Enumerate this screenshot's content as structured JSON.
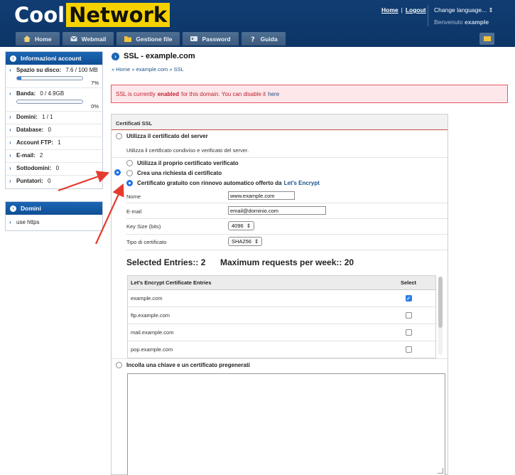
{
  "header": {
    "logo_part1": "Cool",
    "logo_part2": "Network",
    "home_link": "Home",
    "separator": "|",
    "logout_link": "Logout",
    "language": "Change language... ⇕",
    "welcome_prefix": "Benvenuto",
    "welcome_user": "example"
  },
  "nav": {
    "tabs": [
      {
        "label": "Home",
        "icon": "home-icon"
      },
      {
        "label": "Webmail",
        "icon": "mail-icon"
      },
      {
        "label": "Gestione file",
        "icon": "folder-icon"
      },
      {
        "label": "Password",
        "icon": "key-icon"
      },
      {
        "label": "Guida",
        "icon": "help-icon"
      }
    ]
  },
  "sidebar": {
    "account_title": "Informazioni account",
    "disk_label": "Spazio su disco:",
    "disk_value": "7.6 / 100 MB",
    "disk_percent": "7%",
    "disk_fraction": 0.07,
    "band_label": "Banda:",
    "band_value": "0 / 4.9GB",
    "band_percent": "0%",
    "band_fraction": 0,
    "items": [
      {
        "label": "Domini:",
        "value": "1 / 1"
      },
      {
        "label": "Database:",
        "value": "0"
      },
      {
        "label": "Account FTP:",
        "value": "1"
      },
      {
        "label": "E-mail:",
        "value": "2"
      },
      {
        "label": "Sottodomini:",
        "value": "0"
      },
      {
        "label": "Puntatori:",
        "value": "0"
      }
    ],
    "domains_title": "Domini",
    "domains_link": "use https"
  },
  "page": {
    "title": "SSL - example.com",
    "breadcrumb": [
      "Home",
      "example.com",
      "SSL"
    ],
    "crumb_sep": "»",
    "alert_prefix": "SSL is currently",
    "alert_bold": "enabled",
    "alert_suffix": "for this domain. You can disable it",
    "alert_link": "here"
  },
  "ssl": {
    "section_title": "Certificati SSL",
    "opt_server": "Utilizza il certificato del server",
    "opt_server_desc": "Utilizza il certificato condiviso e verificato del server.",
    "opt_own": "Utilizza il proprio certificato verificato",
    "opt_request": "Crea una richiesta di certificato",
    "opt_letsencrypt": "Certificato gratuito con rinnovo automatico offerto da",
    "opt_letsencrypt_link": "Let's Encrypt",
    "name_label": "Nome",
    "name_value": "www.example.com",
    "email_label": "E-mail",
    "email_value": "email@dominio.com",
    "keysize_label": "Key Size (bits)",
    "keysize_value": "4096",
    "cert_type_label": "Tipo di certificato",
    "cert_type_value": "SHA256",
    "selected_entries": "Selected Entries:: 2",
    "max_requests": "Maximum requests per week:: 20",
    "table_col1": "Let's Encrypt Certificate Entries",
    "table_col2": "Select",
    "entries": [
      {
        "name": "example.com",
        "checked": true
      },
      {
        "name": "ftp.example.com",
        "checked": false
      },
      {
        "name": "mail.example.com",
        "checked": false
      },
      {
        "name": "pop.example.com",
        "checked": false
      }
    ],
    "opt_paste": "Incolla una chiave e un certificato pregenerati"
  },
  "colors": {
    "header_bg": "#0d3566",
    "logo_accent": "#f5d100",
    "accent_blue": "#1c66b5",
    "alert_red": "#c0212f",
    "arrow_red": "#e53b2f"
  }
}
